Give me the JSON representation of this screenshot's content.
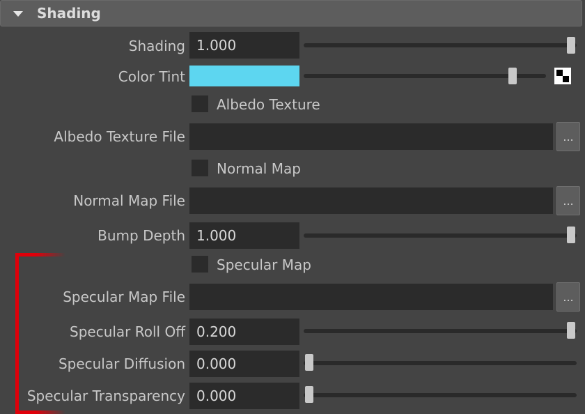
{
  "section": {
    "title": "Shading"
  },
  "colors": {
    "tint": "#5dd6f0",
    "accent_bracket": "#e0000a"
  },
  "browse_label": "...",
  "rows": {
    "shading": {
      "label": "Shading",
      "value": "1.000",
      "slider_fraction": 1.0
    },
    "color_tint": {
      "label": "Color Tint",
      "slider_fraction": 0.86
    },
    "albedo_texture": {
      "label": "Albedo Texture",
      "checked": false
    },
    "albedo_texture_file": {
      "label": "Albedo Texture File",
      "value": ""
    },
    "normal_map": {
      "label": "Normal Map",
      "checked": false
    },
    "normal_map_file": {
      "label": "Normal Map File",
      "value": ""
    },
    "bump_depth": {
      "label": "Bump Depth",
      "value": "1.000",
      "slider_fraction": 1.0
    },
    "specular_map": {
      "label": "Specular Map",
      "checked": false
    },
    "specular_map_file": {
      "label": "Specular Map File",
      "value": ""
    },
    "specular_roll_off": {
      "label": "Specular Roll Off",
      "value": "0.200",
      "slider_fraction": 1.0
    },
    "specular_diffusion": {
      "label": "Specular Diffusion",
      "value": "0.000",
      "slider_fraction": 0.0
    },
    "specular_transparency": {
      "label": "Specular Transparency",
      "value": "0.000",
      "slider_fraction": 0.0
    }
  }
}
